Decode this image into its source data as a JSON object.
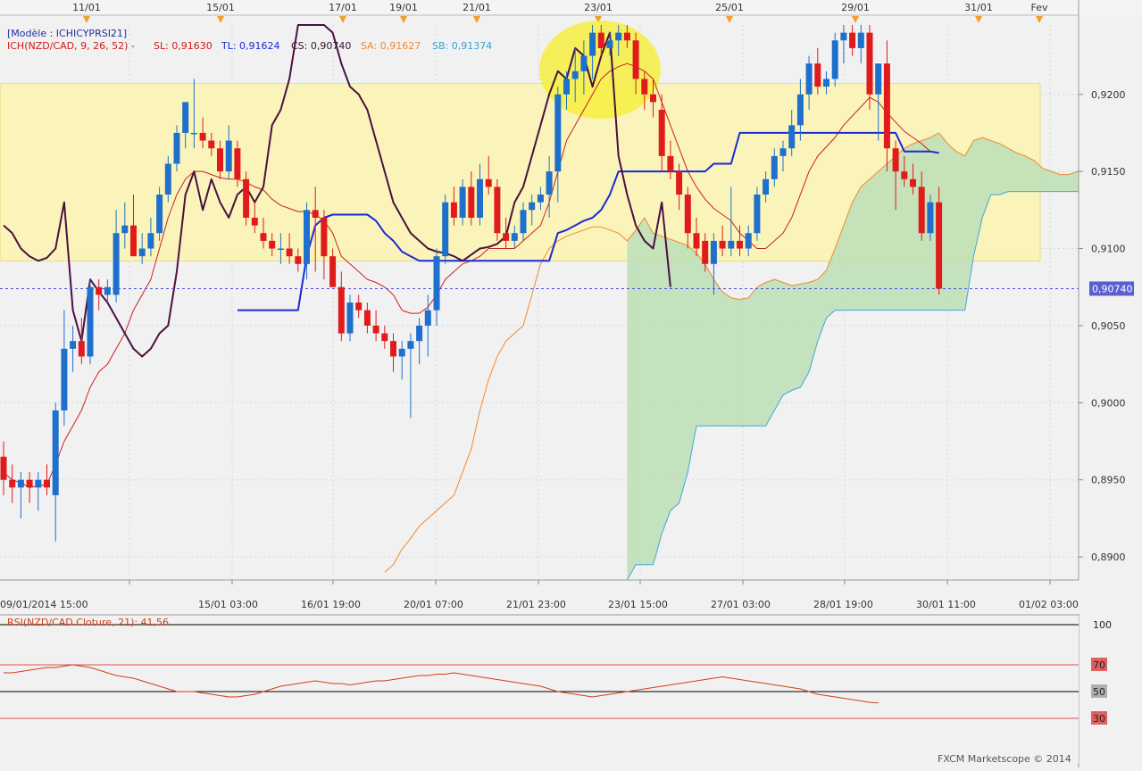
{
  "events_labels": [
    "11/01",
    "15/01",
    "17/01",
    "19/01",
    "21/01",
    "23/01",
    "25/01",
    "29/01",
    "31/01",
    "Fev"
  ],
  "header": {
    "model": "[Modèle : ICHICYPRSI21]",
    "ich_prefix": "ICH(NZD/CAD, 9, 26, 52) -",
    "sl": "SL: 0,91630",
    "tl": "TL: 0,91624",
    "cs": "CS: 0,90740",
    "sa": "SA: 0,91627",
    "sb": "SB: 0,91374"
  },
  "price_axis": {
    "ticks": [
      "0,9200",
      "0,9150",
      "0,9100",
      "0,9050",
      "0,9000",
      "0,8950",
      "0,8900"
    ],
    "current_price_label": "0,90740"
  },
  "time_axis": [
    "09/01/2014 15:00",
    "15/01 03:00",
    "16/01 19:00",
    "20/01 07:00",
    "21/01 23:00",
    "23/01 15:00",
    "27/01 03:00",
    "28/01 19:00",
    "30/01 11:00",
    "01/02 03:00"
  ],
  "rsi": {
    "label": "RSI(NZD/CAD.Cloture, 21): 41,56",
    "ticks": [
      "100",
      "70",
      "50",
      "30"
    ]
  },
  "footer": {
    "copyright": "FXCM Marketscope © 2014"
  },
  "colors": {
    "bull": "#1f6fcc",
    "bear": "#e01b1b",
    "tenkan": "#cc2020",
    "kijun": "#1a2ad6",
    "chikou": "#4a1040",
    "senkou_a": "#f08a30",
    "senkou_b": "#40a8d8",
    "cloud_bull": "#bfe0b8",
    "cloud_bear": "#b5d8ee",
    "zone": "#fbf5b8",
    "highlight": "#f4ee40",
    "rsi_line": "#d04018"
  },
  "chart_data": {
    "type": "candlestick",
    "instrument": "NZD/CAD",
    "ylim": [
      0.8885,
      0.9245
    ],
    "current_price": 0.9074,
    "time_labels": [
      "09/01/2014 15:00",
      "15/01 03:00",
      "16/01 19:00",
      "20/01 07:00",
      "21/01 23:00",
      "23/01 15:00",
      "27/01 03:00",
      "28/01 19:00",
      "30/01 11:00",
      "01/02 03:00"
    ],
    "candles": [
      [
        0.8965,
        0.8975,
        0.894,
        0.895
      ],
      [
        0.895,
        0.896,
        0.8935,
        0.8945
      ],
      [
        0.8945,
        0.8955,
        0.8925,
        0.895
      ],
      [
        0.895,
        0.8955,
        0.8935,
        0.8945
      ],
      [
        0.8945,
        0.8955,
        0.893,
        0.895
      ],
      [
        0.895,
        0.896,
        0.894,
        0.8945
      ],
      [
        0.894,
        0.9,
        0.891,
        0.8995
      ],
      [
        0.8995,
        0.906,
        0.8985,
        0.9035
      ],
      [
        0.9035,
        0.905,
        0.902,
        0.904
      ],
      [
        0.904,
        0.9055,
        0.9025,
        0.903
      ],
      [
        0.903,
        0.908,
        0.9025,
        0.9075
      ],
      [
        0.9075,
        0.908,
        0.906,
        0.907
      ],
      [
        0.907,
        0.908,
        0.9065,
        0.9075
      ],
      [
        0.907,
        0.9125,
        0.9065,
        0.911
      ],
      [
        0.911,
        0.913,
        0.91,
        0.9115
      ],
      [
        0.9115,
        0.9135,
        0.91,
        0.9095
      ],
      [
        0.9095,
        0.911,
        0.909,
        0.91
      ],
      [
        0.91,
        0.912,
        0.9095,
        0.911
      ],
      [
        0.911,
        0.914,
        0.9105,
        0.9135
      ],
      [
        0.9135,
        0.916,
        0.913,
        0.9155
      ],
      [
        0.9155,
        0.918,
        0.915,
        0.9175
      ],
      [
        0.9175,
        0.919,
        0.9165,
        0.9195
      ],
      [
        0.9175,
        0.921,
        0.9165,
        0.9175
      ],
      [
        0.9175,
        0.9185,
        0.9165,
        0.917
      ],
      [
        0.917,
        0.9175,
        0.916,
        0.9165
      ],
      [
        0.9165,
        0.917,
        0.9145,
        0.915
      ],
      [
        0.915,
        0.918,
        0.9145,
        0.917
      ],
      [
        0.9165,
        0.917,
        0.914,
        0.9145
      ],
      [
        0.9145,
        0.915,
        0.9115,
        0.912
      ],
      [
        0.912,
        0.913,
        0.911,
        0.9115
      ],
      [
        0.911,
        0.912,
        0.91,
        0.9105
      ],
      [
        0.9105,
        0.911,
        0.9095,
        0.91
      ],
      [
        0.91,
        0.911,
        0.909,
        0.91
      ],
      [
        0.91,
        0.911,
        0.909,
        0.9095
      ],
      [
        0.9095,
        0.91,
        0.9085,
        0.909
      ],
      [
        0.909,
        0.913,
        0.908,
        0.9125
      ],
      [
        0.9125,
        0.914,
        0.9085,
        0.912
      ],
      [
        0.912,
        0.9125,
        0.908,
        0.9095
      ],
      [
        0.9095,
        0.91,
        0.9075,
        0.9075
      ],
      [
        0.9075,
        0.9085,
        0.904,
        0.9045
      ],
      [
        0.9045,
        0.907,
        0.904,
        0.9065
      ],
      [
        0.9065,
        0.907,
        0.9055,
        0.906
      ],
      [
        0.906,
        0.9065,
        0.9045,
        0.905
      ],
      [
        0.905,
        0.906,
        0.904,
        0.9045
      ],
      [
        0.9045,
        0.905,
        0.9035,
        0.904
      ],
      [
        0.904,
        0.9045,
        0.902,
        0.903
      ],
      [
        0.903,
        0.904,
        0.9015,
        0.9035
      ],
      [
        0.9035,
        0.9045,
        0.899,
        0.904
      ],
      [
        0.904,
        0.9055,
        0.9025,
        0.905
      ],
      [
        0.905,
        0.907,
        0.903,
        0.906
      ],
      [
        0.906,
        0.91,
        0.905,
        0.9095
      ],
      [
        0.9095,
        0.9135,
        0.909,
        0.913
      ],
      [
        0.913,
        0.914,
        0.9115,
        0.912
      ],
      [
        0.912,
        0.9145,
        0.9115,
        0.914
      ],
      [
        0.914,
        0.915,
        0.9115,
        0.912
      ],
      [
        0.912,
        0.9155,
        0.9115,
        0.9145
      ],
      [
        0.9145,
        0.916,
        0.9135,
        0.914
      ],
      [
        0.914,
        0.9145,
        0.9105,
        0.911
      ],
      [
        0.911,
        0.912,
        0.91,
        0.9105
      ],
      [
        0.9105,
        0.9115,
        0.91,
        0.911
      ],
      [
        0.911,
        0.913,
        0.9105,
        0.9125
      ],
      [
        0.9125,
        0.9135,
        0.9115,
        0.913
      ],
      [
        0.913,
        0.914,
        0.9125,
        0.9135
      ],
      [
        0.9135,
        0.916,
        0.912,
        0.915
      ],
      [
        0.915,
        0.9205,
        0.913,
        0.92
      ],
      [
        0.92,
        0.9215,
        0.919,
        0.921
      ],
      [
        0.921,
        0.923,
        0.9195,
        0.9215
      ],
      [
        0.9215,
        0.9235,
        0.92,
        0.9225
      ],
      [
        0.9225,
        0.9245,
        0.921,
        0.924
      ],
      [
        0.924,
        0.9245,
        0.9225,
        0.923
      ],
      [
        0.923,
        0.924,
        0.9225,
        0.9235
      ],
      [
        0.9235,
        0.9245,
        0.9225,
        0.924
      ],
      [
        0.924,
        0.9245,
        0.923,
        0.9235
      ],
      [
        0.9235,
        0.924,
        0.92,
        0.921
      ],
      [
        0.921,
        0.9215,
        0.919,
        0.92
      ],
      [
        0.92,
        0.921,
        0.9185,
        0.9195
      ],
      [
        0.919,
        0.92,
        0.915,
        0.916
      ],
      [
        0.916,
        0.917,
        0.9145,
        0.915
      ],
      [
        0.915,
        0.9155,
        0.9125,
        0.9135
      ],
      [
        0.9135,
        0.914,
        0.91,
        0.911
      ],
      [
        0.911,
        0.912,
        0.9095,
        0.91
      ],
      [
        0.9105,
        0.911,
        0.9085,
        0.909
      ],
      [
        0.909,
        0.911,
        0.907,
        0.9105
      ],
      [
        0.9105,
        0.9115,
        0.9095,
        0.91
      ],
      [
        0.91,
        0.914,
        0.9095,
        0.9105
      ],
      [
        0.9105,
        0.9115,
        0.9095,
        0.91
      ],
      [
        0.91,
        0.9115,
        0.9095,
        0.911
      ],
      [
        0.911,
        0.914,
        0.9105,
        0.9135
      ],
      [
        0.9135,
        0.915,
        0.913,
        0.9145
      ],
      [
        0.9145,
        0.9165,
        0.914,
        0.916
      ],
      [
        0.916,
        0.917,
        0.915,
        0.9165
      ],
      [
        0.9165,
        0.919,
        0.916,
        0.918
      ],
      [
        0.918,
        0.921,
        0.917,
        0.92
      ],
      [
        0.92,
        0.9225,
        0.919,
        0.922
      ],
      [
        0.922,
        0.923,
        0.92,
        0.9205
      ],
      [
        0.9205,
        0.9215,
        0.92,
        0.921
      ],
      [
        0.921,
        0.924,
        0.9205,
        0.9235
      ],
      [
        0.9235,
        0.9245,
        0.922,
        0.924
      ],
      [
        0.924,
        0.9245,
        0.9225,
        0.923
      ],
      [
        0.923,
        0.9245,
        0.922,
        0.924
      ],
      [
        0.924,
        0.9245,
        0.919,
        0.92
      ],
      [
        0.92,
        0.922,
        0.917,
        0.922
      ],
      [
        0.922,
        0.9235,
        0.915,
        0.9165
      ],
      [
        0.9165,
        0.917,
        0.9125,
        0.915
      ],
      [
        0.915,
        0.916,
        0.914,
        0.9145
      ],
      [
        0.9145,
        0.9155,
        0.9135,
        0.914
      ],
      [
        0.914,
        0.915,
        0.9105,
        0.911
      ],
      [
        0.911,
        0.9135,
        0.9105,
        0.913
      ],
      [
        0.913,
        0.914,
        0.907,
        0.9074
      ]
    ],
    "tenkan": [
      0.8955,
      0.895,
      0.8948,
      0.8945,
      0.8946,
      0.8947,
      0.896,
      0.8975,
      0.8985,
      0.8995,
      0.901,
      0.902,
      0.9025,
      0.9035,
      0.9045,
      0.906,
      0.907,
      0.908,
      0.91,
      0.912,
      0.9135,
      0.9145,
      0.915,
      0.915,
      0.9148,
      0.9146,
      0.9145,
      0.9145,
      0.9143,
      0.914,
      0.9138,
      0.9132,
      0.9128,
      0.9126,
      0.9124,
      0.9124,
      0.9122,
      0.9118,
      0.911,
      0.9095,
      0.909,
      0.9085,
      0.908,
      0.9078,
      0.9075,
      0.907,
      0.906,
      0.9058,
      0.9058,
      0.9062,
      0.907,
      0.908,
      0.9085,
      0.909,
      0.9092,
      0.9095,
      0.91,
      0.91,
      0.91,
      0.91,
      0.9105,
      0.911,
      0.9115,
      0.913,
      0.915,
      0.917,
      0.918,
      0.919,
      0.92,
      0.921,
      0.9215,
      0.9218,
      0.922,
      0.9218,
      0.9215,
      0.921,
      0.9195,
      0.918,
      0.9165,
      0.915,
      0.914,
      0.9132,
      0.9126,
      0.9122,
      0.9118,
      0.911,
      0.9105,
      0.91,
      0.91,
      0.9105,
      0.911,
      0.912,
      0.9135,
      0.915,
      0.916,
      0.9166,
      0.9172,
      0.918,
      0.9186,
      0.9192,
      0.9198,
      0.9195,
      0.9188,
      0.9182,
      0.9176,
      0.9172,
      0.9168,
      0.9163
    ],
    "kijun": [
      null,
      null,
      null,
      null,
      null,
      null,
      null,
      null,
      null,
      null,
      null,
      null,
      null,
      null,
      null,
      null,
      null,
      null,
      null,
      null,
      null,
      null,
      null,
      null,
      null,
      null,
      null,
      0.906,
      0.906,
      0.906,
      0.906,
      0.906,
      0.906,
      0.906,
      0.906,
      0.9095,
      0.9115,
      0.912,
      0.9122,
      0.9122,
      0.9122,
      0.9122,
      0.9122,
      0.9118,
      0.911,
      0.9105,
      0.9098,
      0.9095,
      0.9092,
      0.9092,
      0.9092,
      0.9092,
      0.9092,
      0.9092,
      0.9092,
      0.9092,
      0.9092,
      0.9092,
      0.9092,
      0.9092,
      0.9092,
      0.9092,
      0.9092,
      0.9092,
      0.911,
      0.9112,
      0.9115,
      0.9118,
      0.912,
      0.9125,
      0.9135,
      0.915,
      0.915,
      0.915,
      0.915,
      0.915,
      0.915,
      0.915,
      0.915,
      0.915,
      0.915,
      0.915,
      0.9155,
      0.9155,
      0.9155,
      0.9175,
      0.9175,
      0.9175,
      0.9175,
      0.9175,
      0.9175,
      0.9175,
      0.9175,
      0.9175,
      0.9175,
      0.9175,
      0.9175,
      0.9175,
      0.9175,
      0.9175,
      0.9175,
      0.9175,
      0.9175,
      0.9175,
      0.9163,
      0.9163,
      0.9163,
      0.9163,
      0.9162
    ],
    "chikou": [
      0.9115,
      0.911,
      0.91,
      0.9095,
      0.9092,
      0.9094,
      0.91,
      0.913,
      0.906,
      0.904,
      0.908,
      0.9072,
      0.9065,
      0.9055,
      0.9045,
      0.9035,
      0.903,
      0.9035,
      0.9045,
      0.905,
      0.9085,
      0.9135,
      0.915,
      0.9125,
      0.9145,
      0.913,
      0.912,
      0.9135,
      0.914,
      0.913,
      0.914,
      0.918,
      0.919,
      0.921,
      0.925,
      0.925,
      0.9245,
      0.925,
      0.924,
      0.922,
      0.9205,
      0.92,
      0.919,
      0.917,
      0.915,
      0.913,
      0.912,
      0.911,
      0.9105,
      0.91,
      0.9098,
      0.9097,
      0.9095,
      0.9092,
      0.9096,
      0.91,
      0.9101,
      0.9103,
      0.9108,
      0.913,
      0.914,
      0.916,
      0.918,
      0.92,
      0.9215,
      0.921,
      0.923,
      0.9225,
      0.9205,
      0.9225,
      0.924,
      0.916,
      0.9135,
      0.9115,
      0.9105,
      0.91,
      0.913,
      0.9075
    ],
    "chikou_start": 0,
    "senkou_a": [
      null,
      null,
      null,
      null,
      null,
      null,
      null,
      null,
      null,
      null,
      null,
      null,
      null,
      null,
      null,
      null,
      null,
      null,
      null,
      null,
      null,
      null,
      null,
      null,
      null,
      null,
      null,
      null,
      null,
      null,
      null,
      null,
      null,
      null,
      null,
      null,
      null,
      null,
      null,
      null,
      null,
      null,
      null,
      null,
      0.889,
      0.8895,
      0.8905,
      0.8912,
      0.892,
      0.8925,
      0.893,
      0.8935,
      0.894,
      0.8955,
      0.897,
      0.8995,
      0.9015,
      0.903,
      0.904,
      0.9045,
      0.905,
      0.907,
      0.909,
      0.91,
      0.9105,
      0.9108,
      0.911,
      0.9112,
      0.9114,
      0.9114,
      0.9112,
      0.911,
      0.9105,
      0.9112,
      0.912,
      0.911,
      0.9108,
      0.9106,
      0.9104,
      0.9102,
      0.9097,
      0.909,
      0.908,
      0.9072,
      0.9068,
      0.9067,
      0.9068,
      0.9075,
      0.9078,
      0.908,
      0.9078,
      0.9076,
      0.9077,
      0.9078,
      0.908,
      0.9086,
      0.91,
      0.9115,
      0.913,
      0.914,
      0.9145,
      0.915,
      0.9155,
      0.916,
      0.9165,
      0.9168,
      0.917,
      0.9172,
      0.9175,
      0.9168,
      0.9163,
      0.916,
      0.917,
      0.9172,
      0.917,
      0.9168,
      0.9165,
      0.9162,
      0.916,
      0.9157,
      0.9152,
      0.915,
      0.9148,
      0.9148,
      0.915,
      0.9155
    ],
    "senkou_b": [
      null,
      null,
      null,
      null,
      null,
      null,
      null,
      null,
      null,
      null,
      null,
      null,
      null,
      null,
      null,
      null,
      null,
      null,
      null,
      null,
      null,
      null,
      null,
      null,
      null,
      null,
      null,
      null,
      null,
      null,
      null,
      null,
      null,
      null,
      null,
      null,
      null,
      null,
      null,
      null,
      null,
      null,
      null,
      null,
      null,
      null,
      null,
      null,
      null,
      null,
      null,
      null,
      null,
      null,
      null,
      null,
      null,
      null,
      null,
      null,
      null,
      null,
      null,
      null,
      null,
      null,
      null,
      null,
      null,
      null,
      null,
      null,
      0.8885,
      0.8895,
      0.8895,
      0.8895,
      0.8915,
      0.893,
      0.8935,
      0.8955,
      0.8985,
      0.8985,
      0.8985,
      0.8985,
      0.8985,
      0.8985,
      0.8985,
      0.8985,
      0.8985,
      0.8995,
      0.9005,
      0.9008,
      0.901,
      0.902,
      0.904,
      0.9055,
      0.906,
      0.906,
      0.906,
      0.906,
      0.906,
      0.906,
      0.906,
      0.906,
      0.906,
      0.906,
      0.906,
      0.906,
      0.906,
      0.906,
      0.906,
      0.906,
      0.9095,
      0.912,
      0.9135,
      0.9135,
      0.9137,
      0.9137,
      0.9137,
      0.9137,
      0.9137,
      0.9137,
      0.9137,
      0.9137,
      0.9137,
      0.9137,
      0.9137,
      0.9137,
      0.9137,
      0.9137,
      0.9137,
      0.9137,
      0.9137
    ],
    "rsi": [
      64,
      64,
      65,
      66,
      67,
      68,
      68,
      69,
      70,
      69,
      68,
      66,
      64,
      62,
      61,
      60,
      58,
      56,
      54,
      52,
      50,
      50,
      50,
      49,
      48,
      47,
      46,
      46,
      47,
      48,
      50,
      52,
      54,
      55,
      56,
      57,
      58,
      57,
      56,
      56,
      55,
      56,
      57,
      58,
      58,
      59,
      60,
      61,
      62,
      62,
      63,
      63,
      64,
      63,
      62,
      61,
      60,
      59,
      58,
      57,
      56,
      55,
      54,
      52,
      50,
      49,
      48,
      47,
      46,
      47,
      48,
      49,
      50,
      51,
      52,
      53,
      54,
      55,
      56,
      57,
      58,
      59,
      60,
      61,
      60,
      59,
      58,
      57,
      56,
      55,
      54,
      53,
      52,
      50,
      48,
      47,
      46,
      45,
      44,
      43,
      42,
      41.56
    ],
    "rsi_levels": [
      100,
      70,
      50,
      30
    ],
    "zone_band": [
      0.9092,
      0.9207
    ],
    "grid": true
  }
}
